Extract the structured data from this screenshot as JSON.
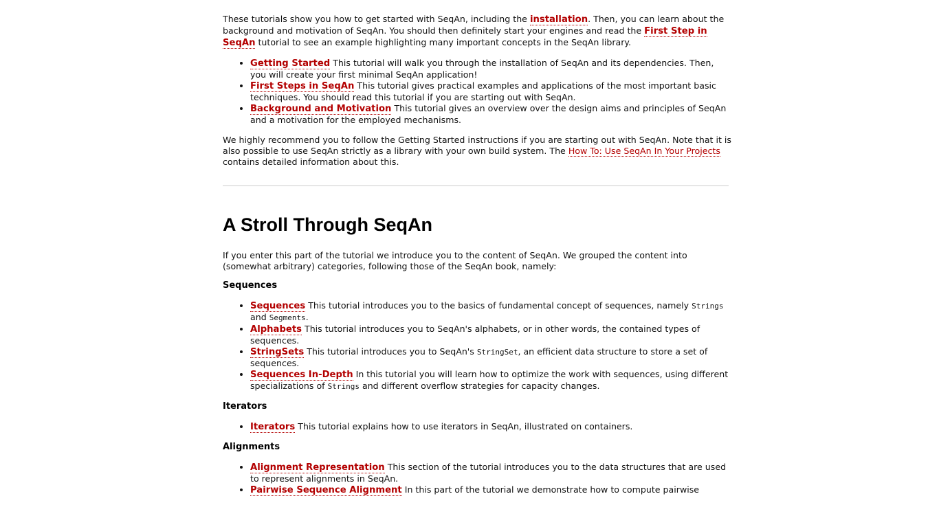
{
  "intro": {
    "text_1": "These tutorials show you how to get started with SeqAn, including the ",
    "link_installation": "installation",
    "text_2": ". Then, you can learn about the background and motivation of SeqAn. You should then definitely start your engines and read the ",
    "link_first_step": "First Step in SeqAn",
    "text_3": " tutorial to see an example highlighting many important concepts in the SeqAn library."
  },
  "getting_started_list": [
    {
      "link": "Getting Started",
      "text": " This tutorial will walk you through the installation of SeqAn and its dependencies. Then, you will create your first minimal SeqAn application!"
    },
    {
      "link": "First Steps in SeqAn",
      "text": " This tutorial gives practical examples and applications of the most important basic techniques. You should read this tutorial if you are starting out with SeqAn."
    },
    {
      "link": "Background and Motivation",
      "text": " This tutorial gives an overview over the design aims and principles of SeqAn and a motivation for the employed mechanisms."
    }
  ],
  "recommend": {
    "text_1": "We highly recommend you to follow the Getting Started instructions if you are starting out with SeqAn. Note that it is also possible to use SeqAn strictly as a library with your own build system. The ",
    "link": "How To: Use SeqAn In Your Projects",
    "text_2": " contains detailed information about this."
  },
  "stroll": {
    "heading": "A Stroll Through SeqAn",
    "intro": "If you enter this part of the tutorial we introduce you to the content of SeqAn. We grouped the content into (somewhat arbitrary) categories, following those of the SeqAn book, namely:"
  },
  "sequences": {
    "heading": "Sequences",
    "items": {
      "sequences": {
        "link": "Sequences",
        "text_1": " This tutorial introduces you to the basics of fundamental concept of sequences, namely ",
        "code_1": "Strings",
        "text_2": " and ",
        "code_2": "Segments",
        "text_3": "."
      },
      "alphabets": {
        "link": "Alphabets",
        "text": " This tutorial introduces you to SeqAn's alphabets, or in other words, the contained types of sequences."
      },
      "stringsets": {
        "link": "StringSets",
        "text_1": " This tutorial introduces you to SeqAn's ",
        "code": "StringSet",
        "text_2": ", an efficient data structure to store a set of sequences."
      },
      "in_depth": {
        "link": "Sequences In-Depth",
        "text_1": " In this tutorial you will learn how to optimize the work with sequences, using different specializations of ",
        "code": "Strings",
        "text_2": " and different overflow strategies for capacity changes."
      }
    }
  },
  "iterators": {
    "heading": "Iterators",
    "items": [
      {
        "link": "Iterators",
        "text": " This tutorial explains how to use iterators in SeqAn, illustrated on containers."
      }
    ]
  },
  "alignments": {
    "heading": "Alignments",
    "items": [
      {
        "link": "Alignment Representation",
        "text": " This section of the tutorial introduces you to the data structures that are used to represent alignments in SeqAn."
      },
      {
        "link": "Pairwise Sequence Alignment",
        "text": " In this part of the tutorial we demonstrate how to compute pairwise"
      }
    ]
  },
  "colors": {
    "link": "#b30000",
    "text": "#111111",
    "rule": "#cccccc"
  }
}
